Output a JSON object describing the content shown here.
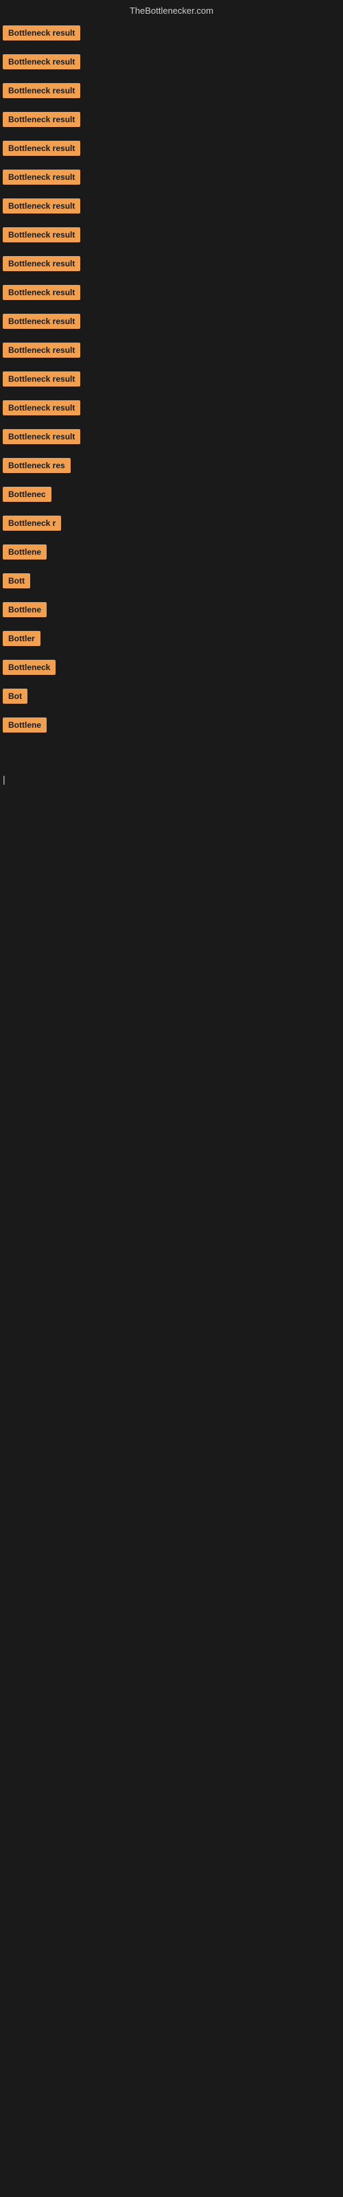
{
  "header": {
    "title": "TheBottlenecker.com"
  },
  "rows": [
    {
      "id": 1,
      "label": "Bottleneck result",
      "visible_text": "Bottleneck result"
    },
    {
      "id": 2,
      "label": "Bottleneck result",
      "visible_text": "Bottleneck result"
    },
    {
      "id": 3,
      "label": "Bottleneck result",
      "visible_text": "Bottleneck result"
    },
    {
      "id": 4,
      "label": "Bottleneck result",
      "visible_text": "Bottleneck result"
    },
    {
      "id": 5,
      "label": "Bottleneck result",
      "visible_text": "Bottleneck result"
    },
    {
      "id": 6,
      "label": "Bottleneck result",
      "visible_text": "Bottleneck result"
    },
    {
      "id": 7,
      "label": "Bottleneck result",
      "visible_text": "Bottleneck result"
    },
    {
      "id": 8,
      "label": "Bottleneck result",
      "visible_text": "Bottleneck result"
    },
    {
      "id": 9,
      "label": "Bottleneck result",
      "visible_text": "Bottleneck result"
    },
    {
      "id": 10,
      "label": "Bottleneck result",
      "visible_text": "Bottleneck result"
    },
    {
      "id": 11,
      "label": "Bottleneck result",
      "visible_text": "Bottleneck result"
    },
    {
      "id": 12,
      "label": "Bottleneck result",
      "visible_text": "Bottleneck result"
    },
    {
      "id": 13,
      "label": "Bottleneck result",
      "visible_text": "Bottleneck result"
    },
    {
      "id": 14,
      "label": "Bottleneck result",
      "visible_text": "Bottleneck result"
    },
    {
      "id": 15,
      "label": "Bottleneck result",
      "visible_text": "Bottleneck result"
    },
    {
      "id": 16,
      "label": "Bottleneck res",
      "visible_text": "Bottleneck res"
    },
    {
      "id": 17,
      "label": "Bottlenec",
      "visible_text": "Bottlenec"
    },
    {
      "id": 18,
      "label": "Bottleneck r",
      "visible_text": "Bottleneck r"
    },
    {
      "id": 19,
      "label": "Bottlene",
      "visible_text": "Bottlene"
    },
    {
      "id": 20,
      "label": "Bott",
      "visible_text": "Bott"
    },
    {
      "id": 21,
      "label": "Bottlene",
      "visible_text": "Bottlene"
    },
    {
      "id": 22,
      "label": "Bottler",
      "visible_text": "Bottler"
    },
    {
      "id": 23,
      "label": "Bottleneck",
      "visible_text": "Bottleneck"
    },
    {
      "id": 24,
      "label": "Bot",
      "visible_text": "Bot"
    },
    {
      "id": 25,
      "label": "Bottlene",
      "visible_text": "Bottlene"
    }
  ],
  "cursor": {
    "symbol": "|"
  }
}
